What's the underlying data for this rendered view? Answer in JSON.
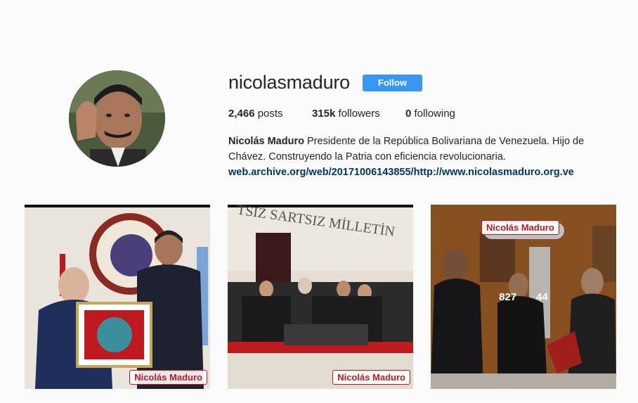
{
  "profile": {
    "username": "nicolasmaduro",
    "follow_label": "Follow",
    "posts_count": "2,466",
    "posts_label": "posts",
    "followers_count": "315k",
    "followers_label": "followers",
    "following_count": "0",
    "following_label": "following",
    "full_name": "Nicolás Maduro",
    "bio_text": "Presidente de la República Bolivariana de Venezuela. Hijo de Chávez. Construyendo la Patria con eficiencia revolucionaria.",
    "website": "web.archive.org/web/20171006143855/http://www.nicolasmaduro.org.ve"
  },
  "posts": [
    {
      "watermark": "Nicolás Maduro"
    },
    {
      "watermark": "Nicolás Maduro"
    },
    {
      "watermark": "Nicolás Maduro",
      "likes": "827",
      "comments": "44"
    }
  ],
  "colors": {
    "follow_button": "#3897f0",
    "link": "#003569",
    "background": "#fafafa"
  }
}
